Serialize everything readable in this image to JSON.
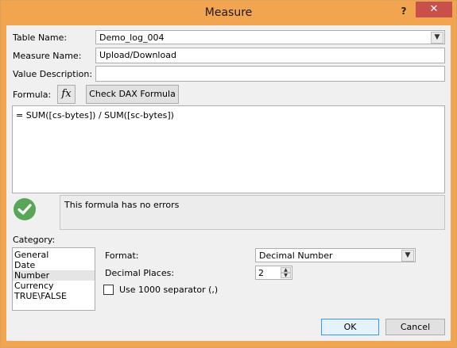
{
  "window": {
    "title": "Measure",
    "help_glyph": "?",
    "close_glyph": "✕"
  },
  "fields": {
    "table_name": {
      "label": "Table Name:",
      "value": "Demo_log_004"
    },
    "measure_name": {
      "label": "Measure Name:",
      "value": "Upload/Download"
    },
    "value_description": {
      "label": "Value Description:",
      "value": ""
    }
  },
  "formula": {
    "label": "Formula:",
    "fx_label": "fx",
    "check_button": "Check DAX Formula",
    "text": "= SUM([cs-bytes]) / SUM([sc-bytes])"
  },
  "status": {
    "message": "This formula has no errors",
    "icon_color": "#58a656"
  },
  "category": {
    "label": "Category:",
    "items": [
      "General",
      "Date",
      "Number",
      "Currency",
      "TRUE\\FALSE"
    ],
    "selected": "Number"
  },
  "format": {
    "format_label": "Format:",
    "format_value": "Decimal Number",
    "decimal_label": "Decimal Places:",
    "decimal_value": "2",
    "separator_label": "Use 1000 separator (,)",
    "separator_checked": false
  },
  "buttons": {
    "ok": "OK",
    "cancel": "Cancel"
  },
  "colors": {
    "titlebar": "#f2a54e",
    "close": "#c7504a",
    "accent_border": "#3399ff"
  }
}
